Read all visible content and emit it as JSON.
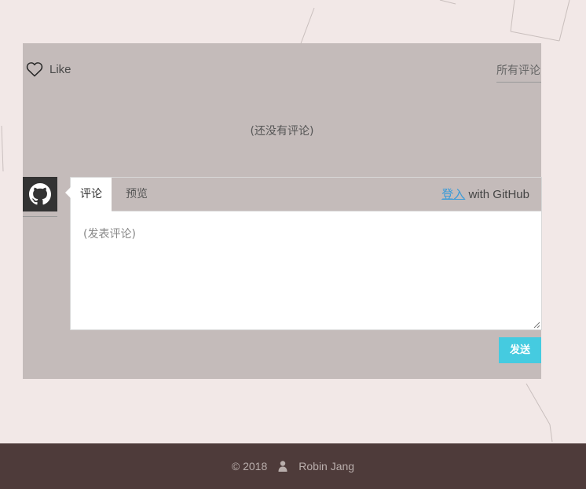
{
  "comments": {
    "like_label": "Like",
    "sort_label": "所有评论",
    "empty_text": "(还没有评论)",
    "tabs": [
      {
        "label": "评论",
        "active": true
      },
      {
        "label": "预览",
        "active": false
      }
    ],
    "login_link": "登入",
    "login_suffix": " with GitHub",
    "placeholder": "(发表评论)",
    "send_label": "发送",
    "avatar_icon": "github-icon",
    "like_icon": "heart-outline-icon",
    "colors": {
      "panel_bg": "#c4bbba",
      "send_button": "#45cbe0",
      "link": "#3b9bd8"
    }
  },
  "footer": {
    "copyright": "© 2018",
    "author_icon": "user-icon",
    "author": "Robin Jang",
    "bg": "#4e3b3a"
  },
  "page": {
    "bg": "#f2e8e7"
  }
}
